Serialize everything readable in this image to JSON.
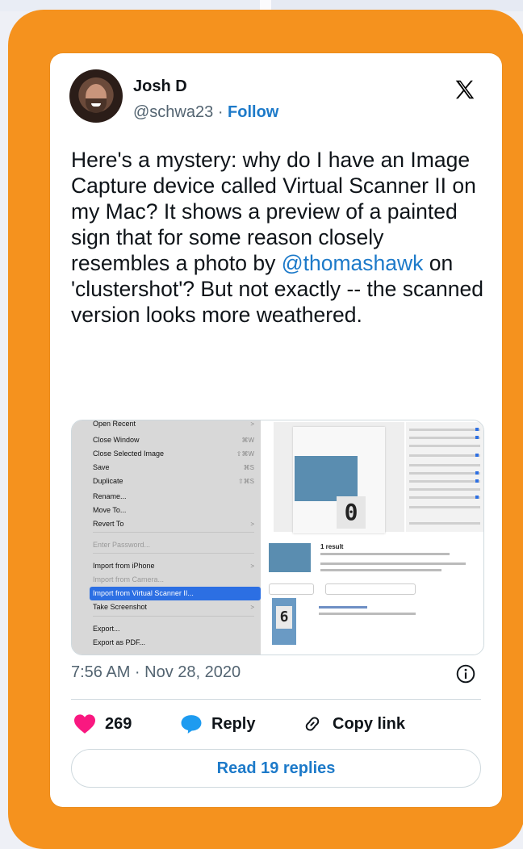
{
  "author": {
    "name": "Josh D",
    "handle": "@schwa23",
    "separator": "·",
    "follow_label": "Follow"
  },
  "brand_icon": "x-logo-icon",
  "tweet": {
    "text_before": "Here's a mystery: why do I have an Image Capture device called Virtual Scanner II on my Mac? It shows a preview of a painted sign that for some reason closely resembles a photo by ",
    "mention": "@thomashawk",
    "text_after": " on 'clustershot'? But not exactly -- the scanned version looks more weathered."
  },
  "media": {
    "menu_items": [
      {
        "label": "Open Recent",
        "shortcut": ">",
        "state": "cut"
      },
      {
        "label": "Close Window",
        "shortcut": "⌘W"
      },
      {
        "label": "Close Selected Image",
        "shortcut": "⇧⌘W"
      },
      {
        "label": "Save",
        "shortcut": "⌘S"
      },
      {
        "label": "Duplicate",
        "shortcut": "⇧⌘S"
      },
      {
        "label": "Rename...",
        "shortcut": ""
      },
      {
        "label": "Move To...",
        "shortcut": ""
      },
      {
        "label": "Revert To",
        "shortcut": ">"
      },
      {
        "label": "Enter Password...",
        "shortcut": "",
        "state": "disabled"
      },
      {
        "label": "Import from iPhone",
        "shortcut": ">"
      },
      {
        "label": "Import from Camera...",
        "shortcut": "",
        "state": "disabled"
      },
      {
        "label": "Import from Virtual Scanner II...",
        "shortcut": "",
        "state": "selected"
      },
      {
        "label": "Take Screenshot",
        "shortcut": ">"
      },
      {
        "label": "Export...",
        "shortcut": ""
      },
      {
        "label": "Export as PDF...",
        "shortcut": ""
      }
    ],
    "scan_digit": "0",
    "result_title": "1 result",
    "result_digit": "6"
  },
  "meta": {
    "timestamp": "7:56 AM · Nov 28, 2020",
    "info_icon": "info-icon"
  },
  "actions": {
    "like_count": "269",
    "reply_label": "Reply",
    "copy_link_label": "Copy link",
    "read_replies_label": "Read 19 replies"
  },
  "colors": {
    "frame": "#f5921e",
    "link": "#1d7ac9",
    "like": "#f91880",
    "reply": "#1d9bf0"
  }
}
